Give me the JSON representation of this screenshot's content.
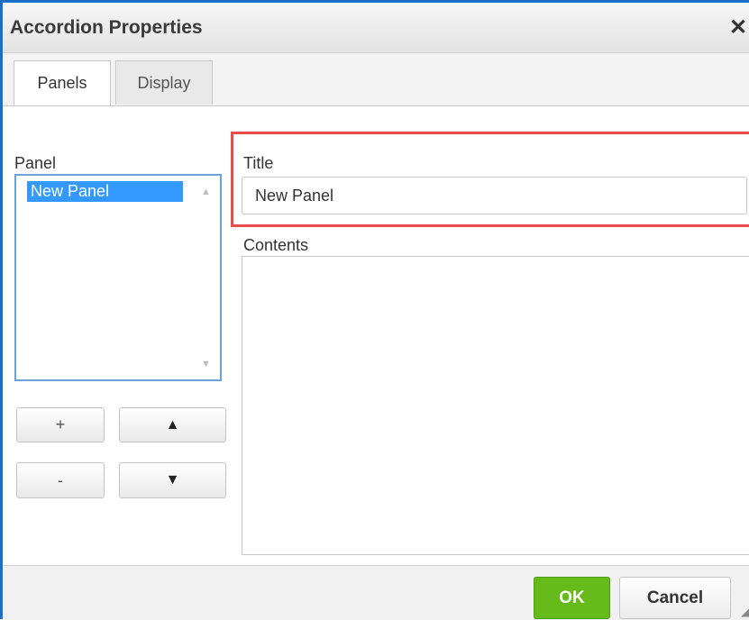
{
  "dialog": {
    "title": "Accordion Properties",
    "close_glyph": "✕"
  },
  "tabs": [
    {
      "label": "Panels",
      "active": true
    },
    {
      "label": "Display",
      "active": false
    }
  ],
  "panel_list": {
    "label": "Panel",
    "items": [
      "New Panel"
    ],
    "selected_index": 0,
    "scroll_up_glyph": "▲",
    "scroll_down_glyph": "▼"
  },
  "list_buttons": {
    "add": "+",
    "remove": "-",
    "move_up": "▲",
    "move_down": "▼"
  },
  "title_field": {
    "label": "Title",
    "value": "New Panel"
  },
  "contents_field": {
    "label": "Contents",
    "value": ""
  },
  "footer": {
    "ok": "OK",
    "cancel": "Cancel"
  },
  "colors": {
    "window_border": "#1a6fc7",
    "ok_green": "#66bb1a",
    "highlight_red": "#e84c4c",
    "selection_blue": "#3399ff"
  }
}
